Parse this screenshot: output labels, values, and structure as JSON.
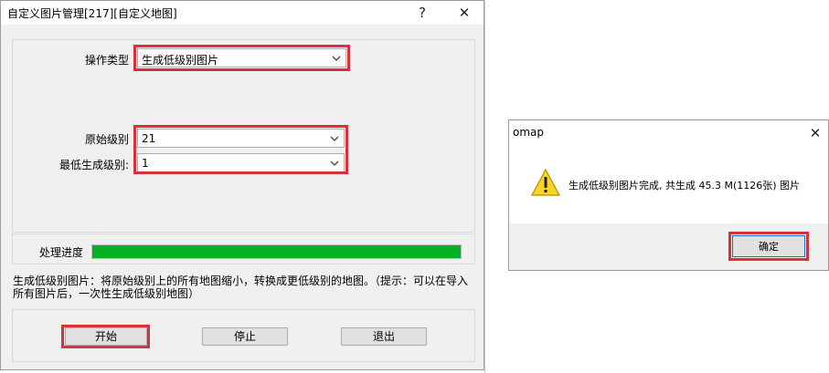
{
  "dialog": {
    "title": "自定义图片管理[217][自定义地图]",
    "help_label": "?",
    "close_label": "✕",
    "operation_type_label": "操作类型",
    "operation_type_value": "生成低级别图片",
    "source_level_label": "原始级别",
    "source_level_value": "21",
    "min_level_label": "最低生成级别:",
    "min_level_value": "1",
    "progress_label": "处理进度",
    "progress": 1.0,
    "description_line1": "生成低级别图片：将原始级别上的所有地图缩小，转换成更低级别的地图。（提示：可以在导入",
    "description_line2": "所有图片后，一次性生成低级别地图）",
    "start_button": "开始",
    "stop_button": "停止",
    "exit_button": "退出"
  },
  "messagebox": {
    "title": "omap",
    "close_label": "✕",
    "message": "生成低级别图片完成, 共生成 45.3 M(1126张) 图片",
    "ok_button": "确定"
  },
  "icons": {
    "warning": "warning-icon",
    "chevron": "chevron-down-icon"
  },
  "colors": {
    "highlight": "#d9313a",
    "progress_fill": "#06b025",
    "warning_fill": "#f9d423"
  }
}
